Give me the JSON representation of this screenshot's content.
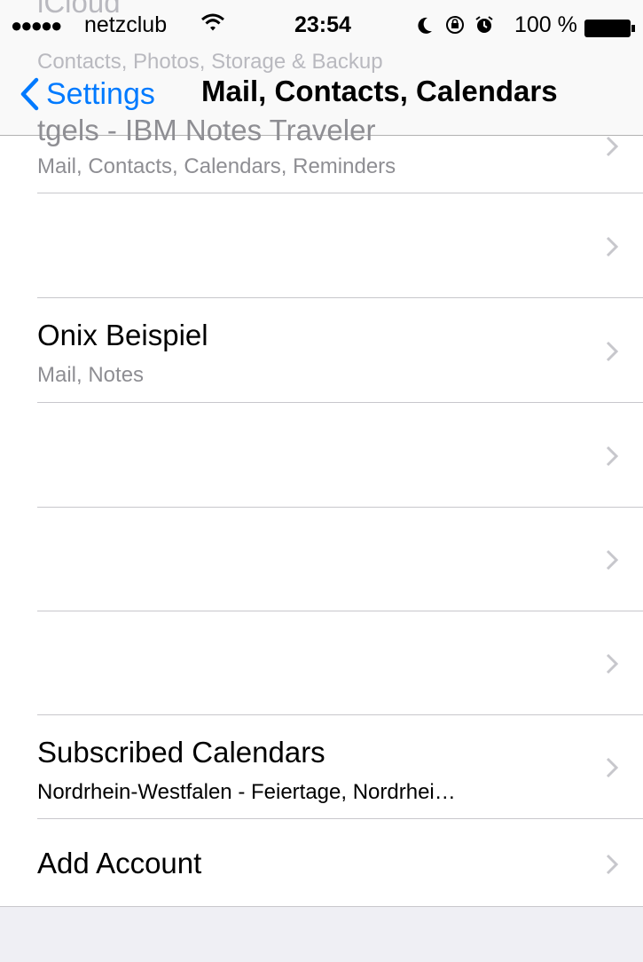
{
  "status_bar": {
    "signal_dots": "●●●●●",
    "carrier": "netzclub",
    "time": "23:54",
    "battery_percent": "100 %",
    "icons": [
      "wifi-icon",
      "moon-icon",
      "orientation-lock-icon",
      "alarm-icon",
      "battery-icon"
    ]
  },
  "nav": {
    "back_label": "Settings",
    "title": "Mail, Contacts, Calendars"
  },
  "scrolled_under": {
    "row0_title": "iCloud",
    "row0_subtitle": "Contacts, Photos, Storage & Backup",
    "row1_title": "tgels - IBM Notes Traveler"
  },
  "accounts": [
    {
      "title": "tgels - IBM Notes Traveler",
      "subtitle": "Mail, Contacts, Calendars, Reminders"
    },
    {
      "title": "",
      "subtitle": ""
    },
    {
      "title": "Onix Beispiel",
      "subtitle": "Mail, Notes"
    },
    {
      "title": "",
      "subtitle": ""
    },
    {
      "title": "",
      "subtitle": ""
    },
    {
      "title": "",
      "subtitle": ""
    },
    {
      "title": "Subscribed Calendars",
      "subtitle": "Nordrhein-Westfalen - Feiertage, Nordrhei…"
    },
    {
      "title": "Add Account",
      "subtitle": ""
    }
  ],
  "colors": {
    "accent": "#007aff",
    "secondary_text": "#8e8e93",
    "separator": "#c8c7cc",
    "group_background": "#efeff4"
  }
}
